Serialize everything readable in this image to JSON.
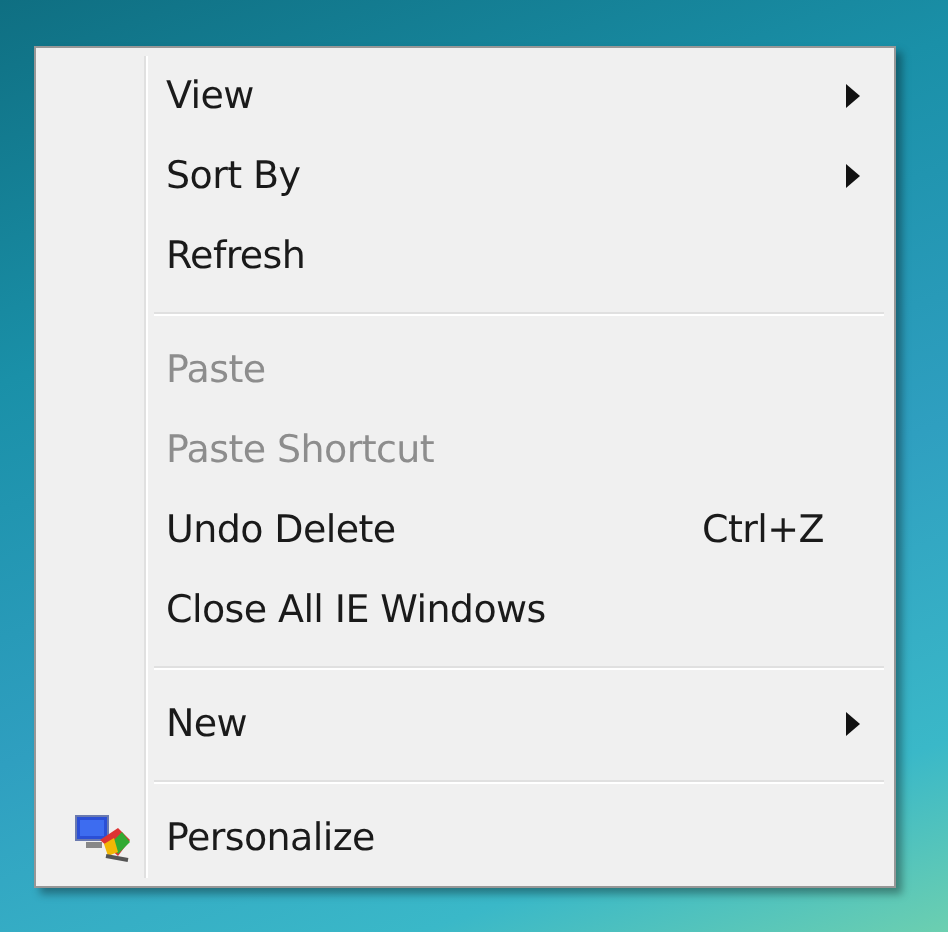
{
  "menu": {
    "items": [
      {
        "kind": "item",
        "label": "View",
        "disabled": false,
        "submenu": true
      },
      {
        "kind": "item",
        "label": "Sort By",
        "disabled": false,
        "submenu": true
      },
      {
        "kind": "item",
        "label": "Refresh",
        "disabled": false,
        "submenu": false
      },
      {
        "kind": "separator"
      },
      {
        "kind": "item",
        "label": "Paste",
        "disabled": true,
        "submenu": false
      },
      {
        "kind": "item",
        "label": "Paste Shortcut",
        "disabled": true,
        "submenu": false
      },
      {
        "kind": "item",
        "label": "Undo Delete",
        "disabled": false,
        "submenu": false,
        "shortcut": "Ctrl+Z"
      },
      {
        "kind": "item",
        "label": "Close All IE Windows",
        "disabled": false,
        "submenu": false
      },
      {
        "kind": "separator"
      },
      {
        "kind": "item",
        "label": "New",
        "disabled": false,
        "submenu": true
      },
      {
        "kind": "separator"
      },
      {
        "kind": "item",
        "label": "Personalize",
        "disabled": false,
        "submenu": false,
        "icon": true
      }
    ]
  }
}
